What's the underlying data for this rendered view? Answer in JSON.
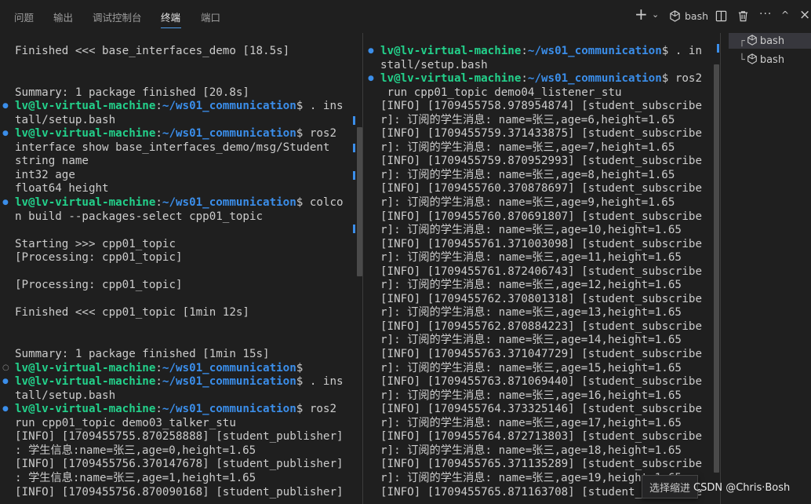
{
  "panel_tabs": [
    {
      "label": "问题",
      "active": false
    },
    {
      "label": "输出",
      "active": false
    },
    {
      "label": "调试控制台",
      "active": false
    },
    {
      "label": "终端",
      "active": true
    },
    {
      "label": "端口",
      "active": false
    }
  ],
  "toolbar": {
    "new_terminal_glyph": "+",
    "dropdown_glyph": "⌄",
    "shell_label": "bash",
    "more_glyph": "···",
    "maximize_glyph": "^",
    "close_glyph": "×"
  },
  "terminal_left": {
    "lines": [
      {
        "parts": [
          {
            "t": "Finished <<< base_interfaces_demo [18.5s]"
          }
        ]
      },
      {
        "parts": [
          {
            "t": ""
          }
        ]
      },
      {
        "parts": [
          {
            "t": ""
          }
        ]
      },
      {
        "parts": [
          {
            "t": "Summary: 1 package finished [20.8s]"
          }
        ]
      },
      {
        "parts": [
          {
            "t": "lv@lv-virtual-machine",
            "c": "user"
          },
          {
            "t": ":"
          },
          {
            "t": "~/ws01_communication",
            "c": "path"
          },
          {
            "t": "$ . ins"
          }
        ]
      },
      {
        "parts": [
          {
            "t": "tall/setup.bash"
          }
        ]
      },
      {
        "parts": [
          {
            "t": "lv@lv-virtual-machine",
            "c": "user"
          },
          {
            "t": ":"
          },
          {
            "t": "~/ws01_communication",
            "c": "path"
          },
          {
            "t": "$ ros2"
          }
        ]
      },
      {
        "parts": [
          {
            "t": "interface show base_interfaces_demo/msg/Student"
          }
        ]
      },
      {
        "parts": [
          {
            "t": "string name"
          }
        ]
      },
      {
        "parts": [
          {
            "t": "int32 age"
          }
        ]
      },
      {
        "parts": [
          {
            "t": "float64 height"
          }
        ]
      },
      {
        "parts": [
          {
            "t": "lv@lv-virtual-machine",
            "c": "user"
          },
          {
            "t": ":"
          },
          {
            "t": "~/ws01_communication",
            "c": "path"
          },
          {
            "t": "$ colco"
          }
        ]
      },
      {
        "parts": [
          {
            "t": "n build --packages-select cpp01_topic"
          }
        ]
      },
      {
        "parts": [
          {
            "t": ""
          }
        ]
      },
      {
        "parts": [
          {
            "t": "Starting >>> cpp01_topic"
          }
        ]
      },
      {
        "parts": [
          {
            "t": "[Processing: cpp01_topic]"
          }
        ]
      },
      {
        "parts": [
          {
            "t": ""
          }
        ]
      },
      {
        "parts": [
          {
            "t": "[Processing: cpp01_topic]"
          }
        ]
      },
      {
        "parts": [
          {
            "t": ""
          }
        ]
      },
      {
        "parts": [
          {
            "t": "Finished <<< cpp01_topic [1min 12s]"
          }
        ]
      },
      {
        "parts": [
          {
            "t": ""
          }
        ]
      },
      {
        "parts": [
          {
            "t": ""
          }
        ]
      },
      {
        "parts": [
          {
            "t": "Summary: 1 package finished [1min 15s]"
          }
        ]
      },
      {
        "parts": [
          {
            "t": "lv@lv-virtual-machine",
            "c": "user"
          },
          {
            "t": ":"
          },
          {
            "t": "~/ws01_communication",
            "c": "path"
          },
          {
            "t": "$"
          }
        ]
      },
      {
        "parts": [
          {
            "t": "lv@lv-virtual-machine",
            "c": "user"
          },
          {
            "t": ":"
          },
          {
            "t": "~/ws01_communication",
            "c": "path"
          },
          {
            "t": "$ . ins"
          }
        ]
      },
      {
        "parts": [
          {
            "t": "tall/setup.bash"
          }
        ]
      },
      {
        "parts": [
          {
            "t": "lv@lv-virtual-machine",
            "c": "user"
          },
          {
            "t": ":"
          },
          {
            "t": "~/ws01_communication",
            "c": "path"
          },
          {
            "t": "$ ros2"
          }
        ]
      },
      {
        "parts": [
          {
            "t": "run cpp01_topic demo03_talker_stu"
          }
        ]
      },
      {
        "parts": [
          {
            "t": "[INFO] [1709455755.870258888] [student_publisher]"
          }
        ]
      },
      {
        "parts": [
          {
            "t": ": 学生信息:name=张三,age=0,height=1.65"
          }
        ]
      },
      {
        "parts": [
          {
            "t": "[INFO] [1709455756.370147678] [student_publisher]"
          }
        ]
      },
      {
        "parts": [
          {
            "t": ": 学生信息:name=张三,age=1,height=1.65"
          }
        ]
      },
      {
        "parts": [
          {
            "t": "[INFO] [1709455756.870090168] [student_publisher]"
          }
        ]
      }
    ]
  },
  "terminal_right": {
    "lines": [
      {
        "parts": [
          {
            "t": "lv@lv-virtual-machine",
            "c": "user"
          },
          {
            "t": ":"
          },
          {
            "t": "~/ws01_communication",
            "c": "path"
          },
          {
            "t": "$ . in"
          }
        ]
      },
      {
        "parts": [
          {
            "t": "stall/setup.bash"
          }
        ]
      },
      {
        "parts": [
          {
            "t": "lv@lv-virtual-machine",
            "c": "user"
          },
          {
            "t": ":"
          },
          {
            "t": "~/ws01_communication",
            "c": "path"
          },
          {
            "t": "$ ros2"
          }
        ]
      },
      {
        "parts": [
          {
            "t": " run cpp01_topic demo04_listener_stu"
          }
        ]
      },
      {
        "parts": [
          {
            "t": "[INFO] [1709455758.978954874] [student_subscribe"
          }
        ]
      },
      {
        "parts": [
          {
            "t": "r]: 订阅的学生消息: name=张三,age=6,height=1.65"
          }
        ]
      },
      {
        "parts": [
          {
            "t": "[INFO] [1709455759.371433875] [student_subscribe"
          }
        ]
      },
      {
        "parts": [
          {
            "t": "r]: 订阅的学生消息: name=张三,age=7,height=1.65"
          }
        ]
      },
      {
        "parts": [
          {
            "t": "[INFO] [1709455759.870952993] [student_subscribe"
          }
        ]
      },
      {
        "parts": [
          {
            "t": "r]: 订阅的学生消息: name=张三,age=8,height=1.65"
          }
        ]
      },
      {
        "parts": [
          {
            "t": "[INFO] [1709455760.370878697] [student_subscribe"
          }
        ]
      },
      {
        "parts": [
          {
            "t": "r]: 订阅的学生消息: name=张三,age=9,height=1.65"
          }
        ]
      },
      {
        "parts": [
          {
            "t": "[INFO] [1709455760.870691807] [student_subscribe"
          }
        ]
      },
      {
        "parts": [
          {
            "t": "r]: 订阅的学生消息: name=张三,age=10,height=1.65"
          }
        ]
      },
      {
        "parts": [
          {
            "t": "[INFO] [1709455761.371003098] [student_subscribe"
          }
        ]
      },
      {
        "parts": [
          {
            "t": "r]: 订阅的学生消息: name=张三,age=11,height=1.65"
          }
        ]
      },
      {
        "parts": [
          {
            "t": "[INFO] [1709455761.872406743] [student_subscribe"
          }
        ]
      },
      {
        "parts": [
          {
            "t": "r]: 订阅的学生消息: name=张三,age=12,height=1.65"
          }
        ]
      },
      {
        "parts": [
          {
            "t": "[INFO] [1709455762.370801318] [student_subscribe"
          }
        ]
      },
      {
        "parts": [
          {
            "t": "r]: 订阅的学生消息: name=张三,age=13,height=1.65"
          }
        ]
      },
      {
        "parts": [
          {
            "t": "[INFO] [1709455762.870884223] [student_subscribe"
          }
        ]
      },
      {
        "parts": [
          {
            "t": "r]: 订阅的学生消息: name=张三,age=14,height=1.65"
          }
        ]
      },
      {
        "parts": [
          {
            "t": "[INFO] [1709455763.371047729] [student_subscribe"
          }
        ]
      },
      {
        "parts": [
          {
            "t": "r]: 订阅的学生消息: name=张三,age=15,height=1.65"
          }
        ]
      },
      {
        "parts": [
          {
            "t": "[INFO] [1709455763.871069440] [student_subscribe"
          }
        ]
      },
      {
        "parts": [
          {
            "t": "r]: 订阅的学生消息: name=张三,age=16,height=1.65"
          }
        ]
      },
      {
        "parts": [
          {
            "t": "[INFO] [1709455764.373325146] [student_subscribe"
          }
        ]
      },
      {
        "parts": [
          {
            "t": "r]: 订阅的学生消息: name=张三,age=17,height=1.65"
          }
        ]
      },
      {
        "parts": [
          {
            "t": "[INFO] [1709455764.872713803] [student_subscribe"
          }
        ]
      },
      {
        "parts": [
          {
            "t": "r]: 订阅的学生消息: name=张三,age=18,height=1.65"
          }
        ]
      },
      {
        "parts": [
          {
            "t": "[INFO] [1709455765.371135289] [student_subscribe"
          }
        ]
      },
      {
        "parts": [
          {
            "t": "r]: 订阅的学生消息: name=张三,age=19,height=1.65"
          }
        ]
      },
      {
        "parts": [
          {
            "t": "[INFO] [1709455765.871163708] [student_subscribe"
          }
        ]
      }
    ]
  },
  "sessions": [
    {
      "label": "bash",
      "active": true
    },
    {
      "label": "bash",
      "active": false
    }
  ],
  "tooltip": "选择缩进",
  "watermark": "CSDN @Chris·Bosh",
  "colors": {
    "user": "#23d18b",
    "path": "#3b8eea",
    "accent": "#4f9ce8"
  }
}
